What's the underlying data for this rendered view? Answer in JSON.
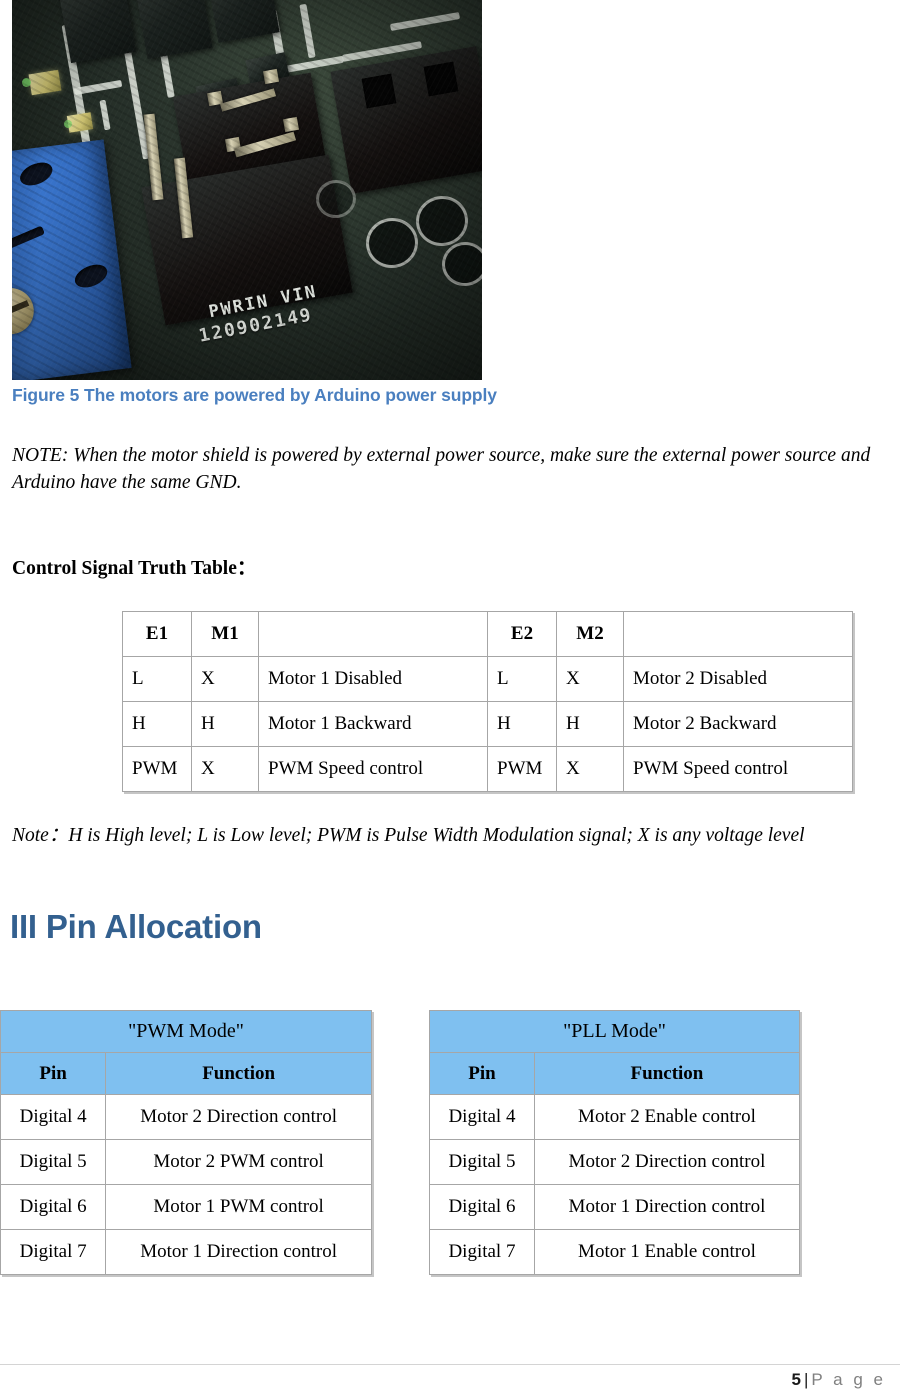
{
  "figure": {
    "caption": "Figure 5 The motors are powered by Arduino power supply",
    "photo": {
      "silkscreen_line1": "PWRIN VIN",
      "silkscreen_line2": "120902149",
      "pcb_color": "#27312a",
      "terminal_block_color": "#3d7ddb",
      "screw_color": "#cfc08a"
    }
  },
  "note_paragraph": "NOTE: When the motor shield is powered by external power source, make sure the external power source and Arduino have the same GND.",
  "truth_table": {
    "title": "Control Signal Truth Table：",
    "headers": [
      "E1",
      "M1",
      "",
      "E2",
      "M2",
      ""
    ],
    "rows": [
      [
        "L",
        "X",
        "Motor 1 Disabled",
        "L",
        "X",
        "Motor 2 Disabled"
      ],
      [
        "H",
        "H",
        "Motor 1 Backward",
        "H",
        "H",
        "Motor 2 Backward"
      ],
      [
        "PWM",
        "X",
        "PWM Speed control",
        "PWM",
        "X",
        "PWM Speed control"
      ]
    ],
    "note": "Note：H is High level; L is Low level; PWM is Pulse Width Modulation signal; X is any voltage level"
  },
  "section": {
    "heading": "III Pin Allocation",
    "heading_color": "#33608f"
  },
  "pin_tables": {
    "header_color": "#7fc0f0",
    "pwm_mode": {
      "title": "\"PWM Mode\"",
      "col_pin": "Pin",
      "col_function": "Function",
      "rows": [
        {
          "pin": "Digital 4",
          "function": "Motor 2 Direction control"
        },
        {
          "pin": "Digital 5",
          "function": "Motor 2 PWM control"
        },
        {
          "pin": "Digital 6",
          "function": "Motor 1 PWM control"
        },
        {
          "pin": "Digital 7",
          "function": "Motor 1 Direction control"
        }
      ]
    },
    "pll_mode": {
      "title": "\"PLL Mode\"",
      "col_pin": "Pin",
      "col_function": "Function",
      "rows": [
        {
          "pin": "Digital 4",
          "function": "Motor 2 Enable control"
        },
        {
          "pin": "Digital 5",
          "function": "Motor 2 Direction control"
        },
        {
          "pin": "Digital 6",
          "function": "Motor 1 Direction control"
        },
        {
          "pin": "Digital 7",
          "function": "Motor 1 Enable control"
        }
      ]
    }
  },
  "footer": {
    "page_number": "5",
    "separator": "|",
    "page_word": "P a g e"
  }
}
